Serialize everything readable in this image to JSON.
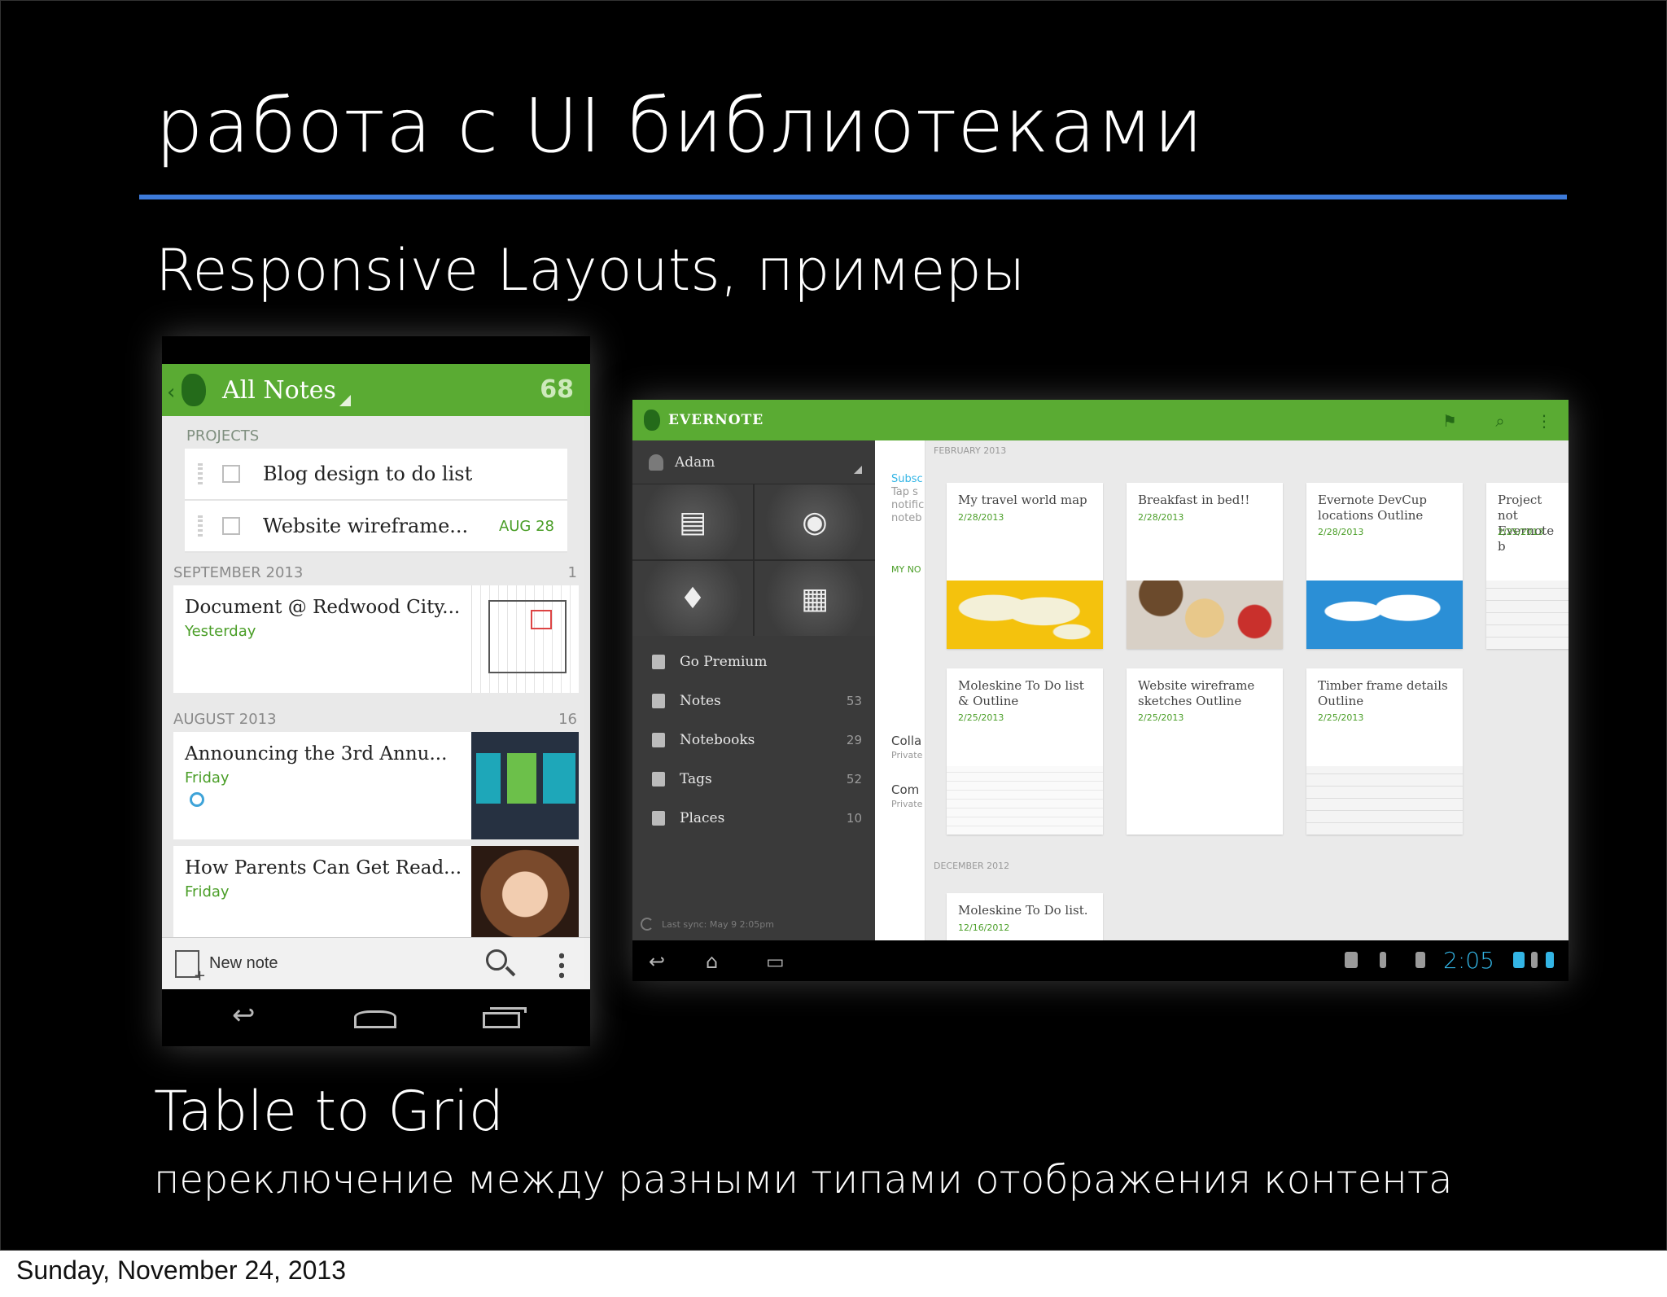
{
  "slide": {
    "title": "работа с UI библиотеками",
    "subtitle": "Responsive Layouts, примеры",
    "bottom_heading": "Table to Grid",
    "bottom_caption": "переключение между разными типами отображения контента",
    "footer_date": "Sunday, November 24, 2013",
    "accent_color": "#3d7ad9"
  },
  "phone": {
    "actionbar": {
      "title": "All Notes",
      "count": "68",
      "color": "#5aab33"
    },
    "projects_label": "PROJECTS",
    "projects": [
      {
        "text": "Blog design to do list",
        "date": ""
      },
      {
        "text": "Website wireframe...",
        "date": "AUG 28"
      }
    ],
    "sections": [
      {
        "label": "SEPTEMBER 2013",
        "count": "1",
        "notes": [
          {
            "title": "Document @ Redwood City...",
            "date": "Yesterday",
            "thumb": "floorplan"
          }
        ]
      },
      {
        "label": "AUGUST 2013",
        "count": "16",
        "notes": [
          {
            "title": "Announcing the 3rd Annu...",
            "date": "Friday",
            "thumb": "ec3-logo"
          },
          {
            "title": "How Parents Can Get Read...",
            "date": "Friday",
            "thumb": "portrait"
          }
        ]
      }
    ],
    "bottombar": {
      "new_note_label": "New note"
    }
  },
  "tablet": {
    "actionbar": {
      "brand": "EVERNOTE",
      "icons": [
        "flag-icon",
        "search-icon",
        "overflow-icon"
      ]
    },
    "drawer": {
      "user": "Adam",
      "tiles": [
        "new-note-icon",
        "camera-icon",
        "microphone-icon",
        "video-icon"
      ],
      "items": [
        {
          "label": "Go Premium",
          "count": ""
        },
        {
          "label": "Notes",
          "count": "53"
        },
        {
          "label": "Notebooks",
          "count": "29"
        },
        {
          "label": "Tags",
          "count": "52"
        },
        {
          "label": "Places",
          "count": "10"
        }
      ],
      "sync": "Last sync: May 9 2:05pm"
    },
    "list_pane": {
      "fragments": [
        "Subsc",
        "Tap s",
        "notific",
        "noteb",
        "MY NO",
        "Colla",
        "Private",
        "Com",
        "Private"
      ]
    },
    "grid": {
      "months": [
        "FEBRUARY 2013",
        "DECEMBER 2012"
      ],
      "cards": [
        {
          "title": "My travel world map",
          "date": "2/28/2013",
          "image": "world-map-yellow"
        },
        {
          "title": "Breakfast in bed!!",
          "date": "2/28/2013",
          "image": "breakfast-photo"
        },
        {
          "title": "Evernote DevCup locations Outline",
          "date": "2/28/2013",
          "image": "world-map-blue"
        },
        {
          "title": "Project not Evernote b",
          "date": "2/25/2013",
          "image": "sketch"
        },
        {
          "title": "Moleskine To Do list & Outline",
          "date": "2/25/2013",
          "image": "sketch"
        },
        {
          "title": "Website wireframe sketches Outline",
          "date": "2/25/2013",
          "image": ""
        },
        {
          "title": "Timber frame details Outline",
          "date": "2/25/2013",
          "image": "sketch"
        },
        {
          "title": "Moleskine To Do list.",
          "date": "12/16/2012",
          "image": ""
        }
      ]
    },
    "navbar": {
      "clock": "2:05"
    }
  }
}
